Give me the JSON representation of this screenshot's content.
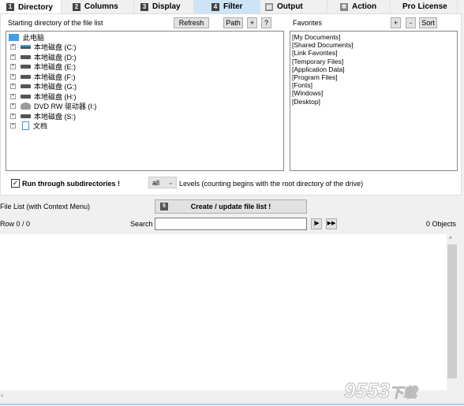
{
  "tabs": [
    {
      "num": "1",
      "label": "Directory",
      "active": true
    },
    {
      "num": "2",
      "label": "Columns"
    },
    {
      "num": "3",
      "label": "Display"
    },
    {
      "num": "4",
      "label": "Filter",
      "highlighted": true
    },
    {
      "num": "",
      "label": "Output",
      "icon": "document-icon"
    },
    {
      "num": "",
      "label": "Action",
      "icon": "gear-icon"
    },
    {
      "num": "",
      "label": "Pro License"
    }
  ],
  "directory": {
    "label": "Starting directory of the file list",
    "refresh": "Refresh",
    "path": "Path",
    "plus": "+",
    "help": "?",
    "tree": [
      {
        "label": "此电脑",
        "icon": "computer-icon",
        "root": true
      },
      {
        "label": "本地磁盘 (C:)",
        "icon": "system-drive-icon"
      },
      {
        "label": "本地磁盘 (D:)",
        "icon": "drive-icon"
      },
      {
        "label": "本地磁盘 (E:)",
        "icon": "drive-icon"
      },
      {
        "label": "本地磁盘 (F:)",
        "icon": "drive-icon"
      },
      {
        "label": "本地磁盘 (G:)",
        "icon": "drive-icon"
      },
      {
        "label": "本地磁盘 (H:)",
        "icon": "drive-icon"
      },
      {
        "label": "DVD RW 驱动器 (I:)",
        "icon": "dvd-drive-icon"
      },
      {
        "label": "本地磁盘 (S:)",
        "icon": "drive-icon"
      },
      {
        "label": "文档",
        "icon": "documents-folder-icon"
      }
    ]
  },
  "favorites": {
    "label": "Favorites",
    "plus": "+",
    "minus": "-",
    "sort": "Sort",
    "items": [
      "[My Documents]",
      "[Shared Documents]",
      "[Link Favorites]",
      "[Temporary Files]",
      "[Application Data]",
      "[Program Files]",
      "[Fonts]",
      "[Windows]",
      "[Desktop]"
    ]
  },
  "options": {
    "run_sub": "Run through subdirectories !",
    "run_sub_checked": true,
    "levels_value": "all",
    "levels_text": "Levels  (counting begins with the root directory of the drive)"
  },
  "filelist": {
    "label": "File List (with Context Menu)",
    "create_num": "5",
    "create": "Create / update file list !",
    "row": "Row 0 / 0",
    "search_label": "Search",
    "search_value": "",
    "objects": "0 Objects"
  },
  "watermark": "9553下载"
}
